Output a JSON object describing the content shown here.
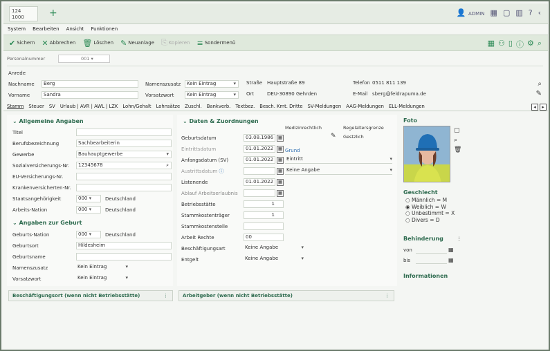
{
  "tab": {
    "line1": "124",
    "line2": "1000",
    "plus": "+"
  },
  "top_icons": [
    "user-icon",
    "grid-icon",
    "window-icon",
    "help-icon",
    "back-icon"
  ],
  "top_user": "ADMIN",
  "menu": [
    "System",
    "Bearbeiten",
    "Ansicht",
    "Funktionen"
  ],
  "toolbar": [
    {
      "label": "Sichern",
      "icon": "✔",
      "enabled": true
    },
    {
      "label": "Abbrechen",
      "icon": "✕",
      "enabled": true
    },
    {
      "label": "Löschen",
      "icon": "🗑",
      "enabled": true
    },
    {
      "label": "Neuanlage",
      "icon": "✎",
      "enabled": true
    },
    {
      "label": "Kopieren",
      "icon": "⎘",
      "enabled": false
    },
    {
      "label": "Sondermenü",
      "icon": "≡",
      "enabled": true
    }
  ],
  "search_label": "Personalnummer",
  "search_value": "001",
  "identity": {
    "section": "Anrede",
    "nachname_label": "Nachname",
    "nachname": "Berg",
    "vorname_label": "Vorname",
    "vorname": "Sandra",
    "namenszusatz_label": "Namenszusatz",
    "namenszusatz": "Kein Eintrag",
    "vorsatzwort_label": "Vorsatzwort",
    "vorsatzwort": "Kein Eintrag",
    "strasse_label": "Straße",
    "strasse": "Hauptstraße 89",
    "ort_label": "Ort",
    "ort": "DEU-30890 Gehrden",
    "telefon_label": "Telefon",
    "telefon": "0511 811 139",
    "email_label": "E-Mail",
    "email": "sberg@feldrapuma.de"
  },
  "tabs": [
    "Stamm",
    "Steuer",
    "SV",
    "Urlaub | AVR | AWL | LZK",
    "Lohn/Gehalt",
    "Lohnsätze",
    "Zuschl.",
    "Bankverb.",
    "Textbez.",
    "Besch. Kmt. Dritte",
    "SV-Meldungen",
    "AAG-Meldungen",
    "ELL-Meldungen"
  ],
  "allg": {
    "title": "Allgemeine Angaben",
    "rows": [
      {
        "label": "Titel",
        "value": ""
      },
      {
        "label": "Berufsbezeichnung",
        "value": "Sachbearbeiterin"
      },
      {
        "label": "Gewerbe",
        "value": "Bauhauptgewerbe"
      },
      {
        "label": "Sozialversicherungs-Nr.",
        "value": "12345678"
      },
      {
        "label": "EU-Versicherungs-Nr.",
        "value": ""
      },
      {
        "label": "Krankenversicherten-Nr.",
        "value": ""
      },
      {
        "label": "Staatsangehörigkeit",
        "value": "000",
        "extra": "Deutschland"
      },
      {
        "label": "Arbeits-Nation",
        "value": "000",
        "extra": "Deutschland"
      }
    ]
  },
  "geburt": {
    "title": "Angaben zur Geburt",
    "rows": [
      {
        "label": "Geburts-Nation",
        "value": "000",
        "extra": "Deutschland"
      },
      {
        "label": "Geburtsort",
        "value": "Hildesheim"
      },
      {
        "label": "Geburtsname",
        "value": ""
      },
      {
        "label": "Namenszusatz",
        "value": "Kein Eintrag"
      },
      {
        "label": "Vorsatzwort",
        "value": "Kein Eintrag"
      }
    ]
  },
  "daten": {
    "title": "Daten & Zuordnungen",
    "rows": [
      {
        "label": "Geburtsdatum",
        "value": "03.08.1986"
      },
      {
        "label": "Eintrittsdatum",
        "value": "01.01.2022"
      },
      {
        "label": "Anfangsdatum (SV)",
        "value": "01.01.2022"
      },
      {
        "label": "Austrittsdatum",
        "value": ""
      },
      {
        "label": "Listenende",
        "value": "01.01.2022"
      },
      {
        "label": "Ablauf Arbeitserlaubnis",
        "value": ""
      },
      {
        "label": "Betriebsstätte",
        "value": "1"
      },
      {
        "label": "Stammkostenträger",
        "value": "1"
      },
      {
        "label": "Stammkostenstelle",
        "value": ""
      },
      {
        "label": "Arbeit Rechte",
        "value": "00"
      },
      {
        "label": "Beschäftigungsart",
        "value": "Keine Angabe"
      },
      {
        "label": "Entgelt",
        "value": "Keine Angabe"
      }
    ],
    "side_a": "Medizinrechtlich",
    "side_b": "Regelaltersgrenze",
    "side_c": "Gestzlich",
    "grund_label": "Grund",
    "grund_eintritt": "Eintritt",
    "grund_austritt": "Keine Angabe"
  },
  "foto": {
    "title": "Foto"
  },
  "geschlecht": {
    "title": "Geschlecht",
    "options": [
      "Männlich = M",
      "Weiblich = W",
      "Unbestimmt = X",
      "Divers = D"
    ],
    "selected": 1
  },
  "behinderung": {
    "title": "Behinderung",
    "von": "von",
    "bis": "bis"
  },
  "informationen": "Informationen",
  "bottom": {
    "left": "Beschäftigungsort (wenn nicht Betriebsstätte)",
    "right": "Arbeitgeber (wenn nicht Betriebsstätte)"
  }
}
